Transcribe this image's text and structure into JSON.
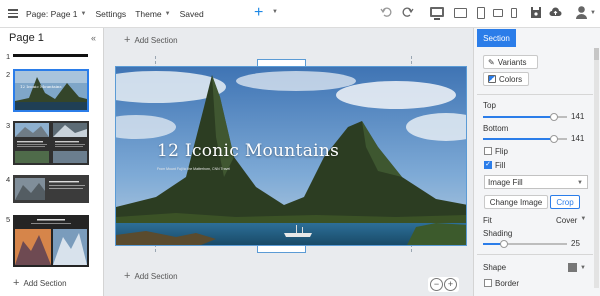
{
  "toolbar": {
    "page_menu": "Page: Page 1",
    "settings": "Settings",
    "theme": "Theme",
    "status": "Saved"
  },
  "left": {
    "title": "Page 1",
    "collapse": "«",
    "pages": [
      "1",
      "2",
      "3",
      "4",
      "5"
    ],
    "add_section": "Add Section"
  },
  "canvas": {
    "add_section_top": "Add Section",
    "add_section_bottom": "Add Section",
    "hero_title": "12 Iconic Mountains",
    "hero_subtitle": "From Mount Fuji to the Matterhorn, CNN Travel"
  },
  "right": {
    "tab": "Section",
    "variants": "Variants",
    "colors": "Colors",
    "top_label": "Top",
    "top_value": "141",
    "bottom_label": "Bottom",
    "bottom_value": "141",
    "flip": "Flip",
    "fill": "Fill",
    "fill_type": "Image Fill",
    "change_image": "Change Image",
    "crop": "Crop",
    "fit_label": "Fit",
    "fit_value": "Cover",
    "shading_label": "Shading",
    "shading_value": "25",
    "shape_label": "Shape",
    "border": "Border"
  },
  "state": {
    "top_pct": 0.85,
    "bottom_pct": 0.85,
    "shading_pct": 0.25,
    "fill_checked": true,
    "flip_checked": false
  },
  "colors": {
    "accent": "#2b7de9",
    "selection": "#5b9bd5"
  }
}
